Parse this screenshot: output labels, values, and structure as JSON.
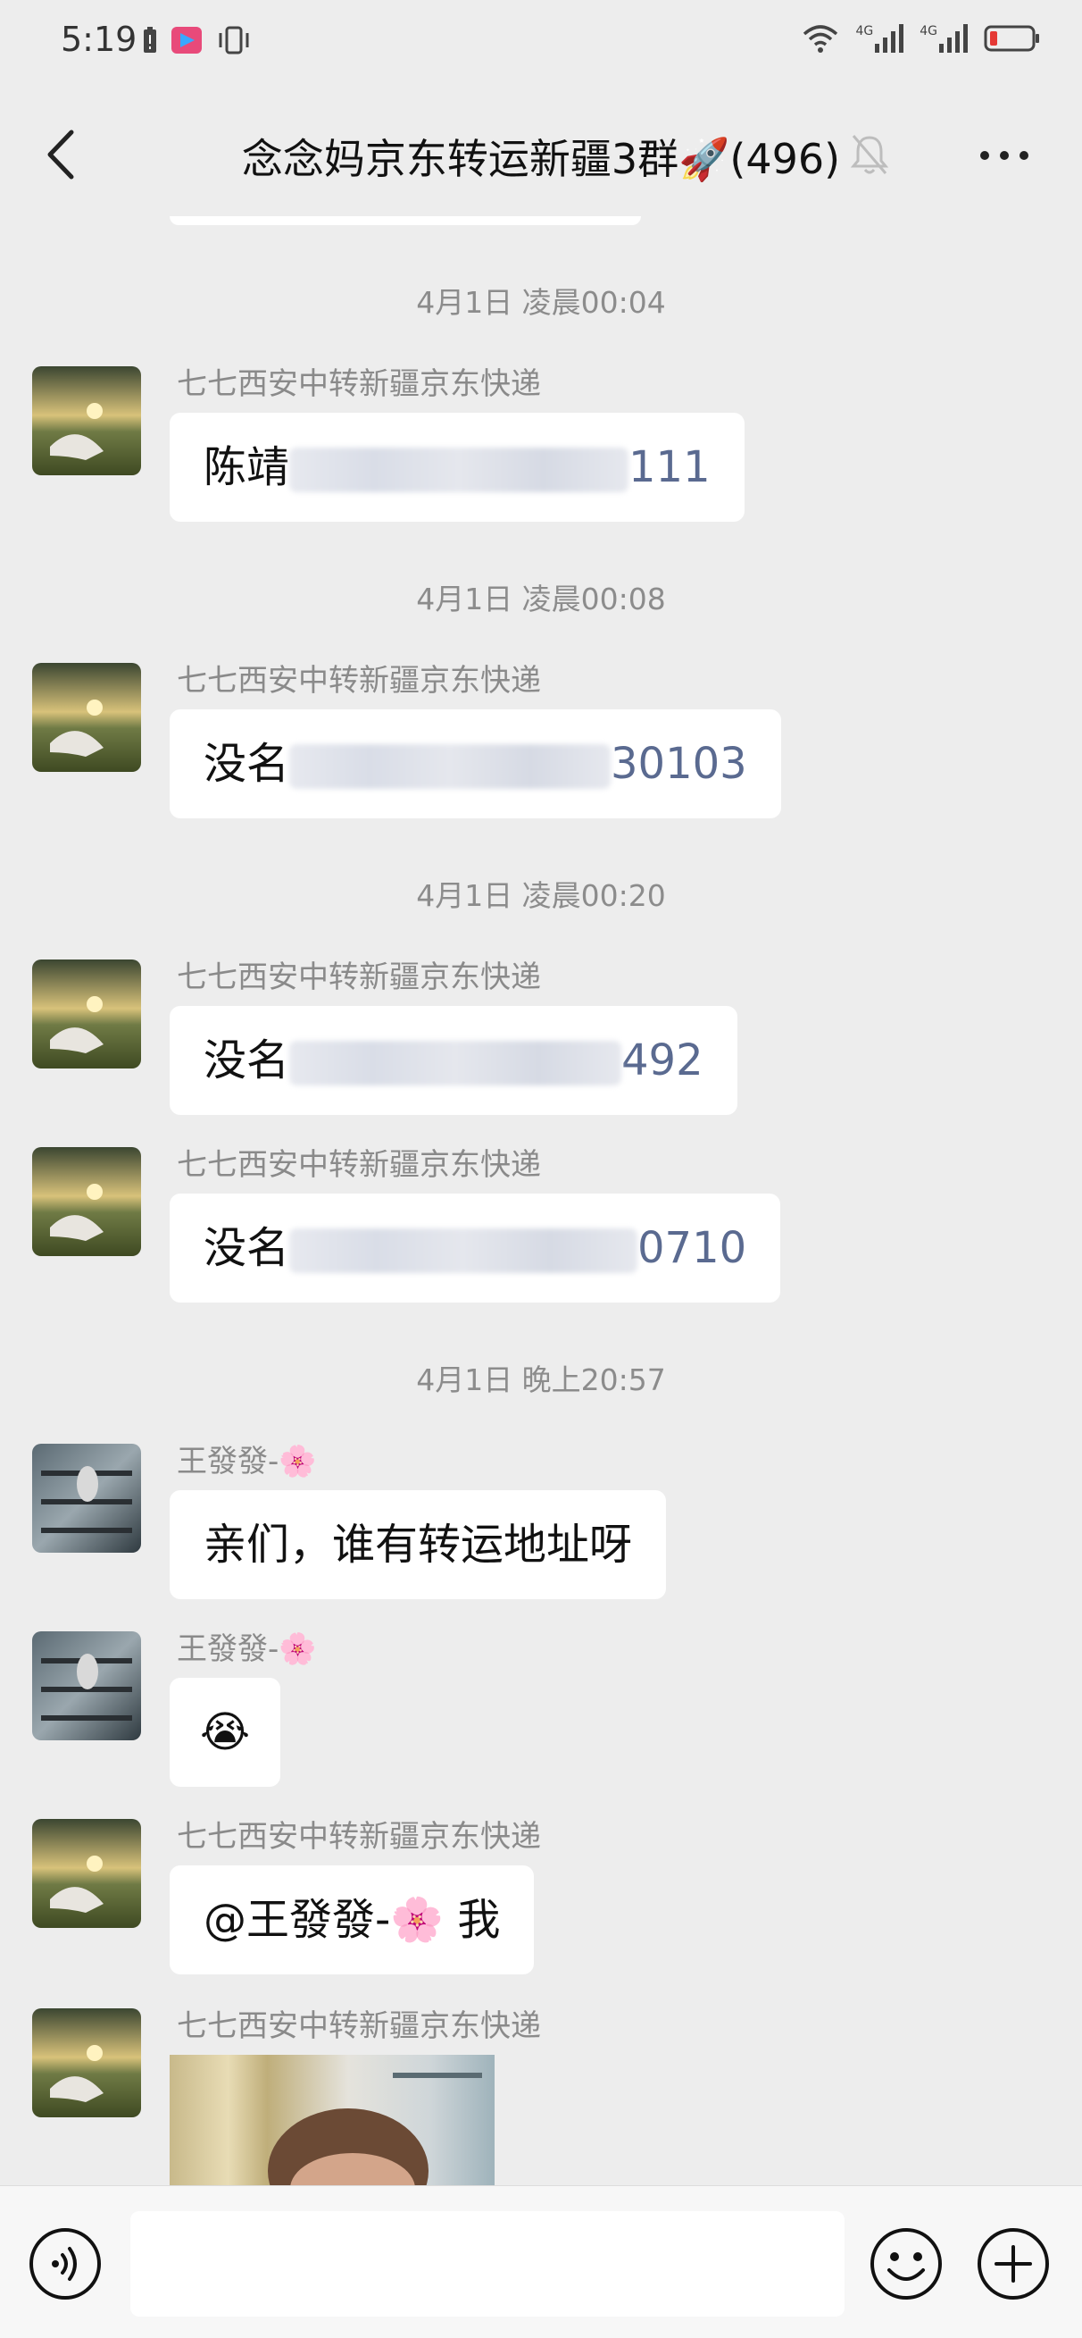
{
  "status_bar": {
    "time": "5:19",
    "net1": "4G",
    "net2": "4G"
  },
  "header": {
    "title": "念念妈京东转运新疆3群🚀(496)"
  },
  "messages": [
    {
      "timestamp": "4月1日 凌晨00:04",
      "sender": "七七西安中转新疆京东快递",
      "text_prefix": "陈靖",
      "text_suffix": "111"
    },
    {
      "timestamp": "4月1日 凌晨00:08",
      "sender": "七七西安中转新疆京东快递",
      "text_prefix": "没名",
      "text_suffix": "30103"
    },
    {
      "timestamp": "4月1日 凌晨00:20",
      "sender": "七七西安中转新疆京东快递",
      "text_prefix": "没名",
      "text_suffix": "492"
    },
    {
      "sender": "七七西安中转新疆京东快递",
      "text_prefix": "没名",
      "text_suffix": "0710"
    },
    {
      "timestamp": "4月1日 晚上20:57",
      "sender": "王發發-🌸",
      "text": "亲们，谁有转运地址呀"
    },
    {
      "sender": "王發發-🌸",
      "text": "😭"
    },
    {
      "sender": "七七西安中转新疆京东快递",
      "text": "@王發發-🌸  我"
    },
    {
      "sender": "七七西安中转新疆京东快递",
      "image": "photo"
    }
  ],
  "icons": {
    "back": "chevron-left-icon",
    "mute": "bell-off-icon",
    "more": "more-dots-icon",
    "voice": "voice-icon",
    "emoji": "emoji-icon",
    "plus": "plus-icon"
  },
  "colors": {
    "background": "#ededed",
    "bubble": "#ffffff",
    "timestamp": "#8c8c8c",
    "sender": "#8a8a8a"
  }
}
